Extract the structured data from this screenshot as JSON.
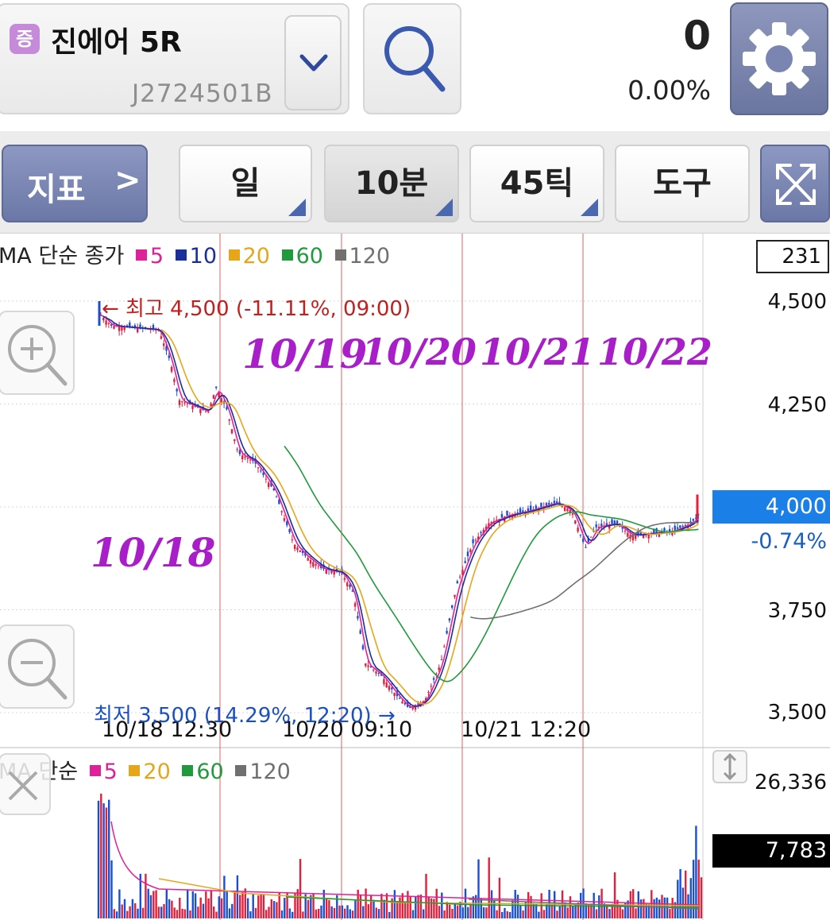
{
  "header": {
    "stock_badge": "증",
    "stock_name": "진에어 5R",
    "stock_code": "J2724501B",
    "price": "0",
    "change_pct": "0.00%"
  },
  "toolbar": {
    "indicator_label": "지표",
    "indicator_chevron": ">",
    "period_day": "일",
    "period_10min": "10분",
    "period_45tick": "45틱",
    "tools": "도구"
  },
  "price_chart": {
    "legend_title": "MA 단순 종가",
    "ma_items": [
      {
        "label": "5",
        "color": "#e0209a"
      },
      {
        "label": "10",
        "color": "#1a2f9c"
      },
      {
        "label": "20",
        "color": "#e7a51a"
      },
      {
        "label": "60",
        "color": "#1f9a3c"
      },
      {
        "label": "120",
        "color": "#707070"
      }
    ],
    "count": "231",
    "y_ticks": [
      "4,500",
      "4,250",
      "4,000",
      "3,750",
      "3,500"
    ],
    "x_ticks": [
      "10/18 12:30",
      "10/20 09:10",
      "10/21 12:20"
    ],
    "current_price": "4,000",
    "current_change": "-0.74%",
    "high_label": "← 최고 4,500 (-11.11%, 09:00)",
    "low_label": "최저 3,500 (14.29%, 12:20) →",
    "handwritten": [
      "10/18",
      "10/19",
      "10/20",
      "10/21",
      "10/22"
    ]
  },
  "volume_chart": {
    "legend_title": "MA 단순",
    "ma_items": [
      {
        "label": "5",
        "color": "#e0209a"
      },
      {
        "label": "20",
        "color": "#e7a51a"
      },
      {
        "label": "60",
        "color": "#1f9a3c"
      },
      {
        "label": "120",
        "color": "#707070"
      }
    ],
    "max_volume": "26,336",
    "current_volume": "7,783"
  },
  "colors": {
    "up": "#e0203c",
    "down": "#1a50d0",
    "accent_button": "#7a85b2",
    "current_price_bg": "#1a7fe6"
  },
  "icons": [
    "chevron-down-icon",
    "search-icon",
    "gear-icon",
    "expand-icon",
    "zoom-in-icon",
    "zoom-out-icon",
    "close-icon",
    "resize-icon"
  ]
}
